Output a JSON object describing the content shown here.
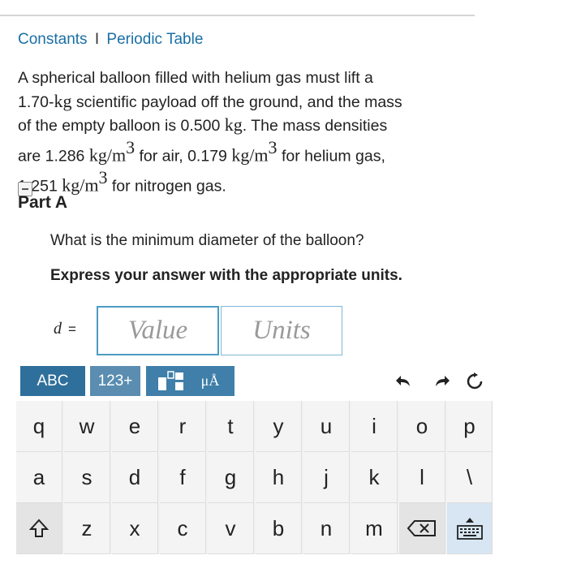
{
  "header": {
    "constants_link": "Constants",
    "separator": "I",
    "periodic_link": "Periodic Table"
  },
  "problem": {
    "l1_text": "A spherical balloon filled with helium gas must lift a",
    "l2_num": "1.70-",
    "l2_unit": "kg",
    "l2_text": " scientific payload off the ground, and the mass",
    "l3_text": "of the empty balloon is 0.500 ",
    "l3_unit": "kg",
    "l3_end": ". The mass densities",
    "l4_pre": "are 1.286 ",
    "unit_density": "kg/m",
    "exp": "3",
    "l4_mid": " for air, 0.179 ",
    "l4_end": " for helium gas,",
    "l5_pre": "1.251 ",
    "l5_end": " for nitrogen gas."
  },
  "part": {
    "label": "Part A",
    "question": "What is the minimum diameter of the balloon?",
    "instruction": "Express your answer with the appropriate units."
  },
  "answer": {
    "variable": "d",
    "equals": "=",
    "value_placeholder": "Value",
    "units_placeholder": "Units"
  },
  "keyboard": {
    "modes": {
      "abc": "ABC",
      "num": "123+",
      "templates": "▯⁰▯",
      "units": "μÅ"
    },
    "row1": [
      "q",
      "w",
      "e",
      "r",
      "t",
      "y",
      "u",
      "i",
      "o",
      "p"
    ],
    "row2": [
      "a",
      "s",
      "d",
      "f",
      "g",
      "h",
      "j",
      "k",
      "l",
      "\\"
    ],
    "row3": [
      "z",
      "x",
      "c",
      "v",
      "b",
      "n",
      "m"
    ],
    "icons": {
      "undo": "undo-icon",
      "redo": "redo-icon",
      "reset": "reset-icon",
      "shift": "shift-icon",
      "backspace": "backspace-icon",
      "keyboard": "keyboard-icon"
    }
  },
  "colors": {
    "link": "#1a6fa5",
    "mode_button": "#3f7fa9",
    "field_border": "#4d9bc2"
  }
}
